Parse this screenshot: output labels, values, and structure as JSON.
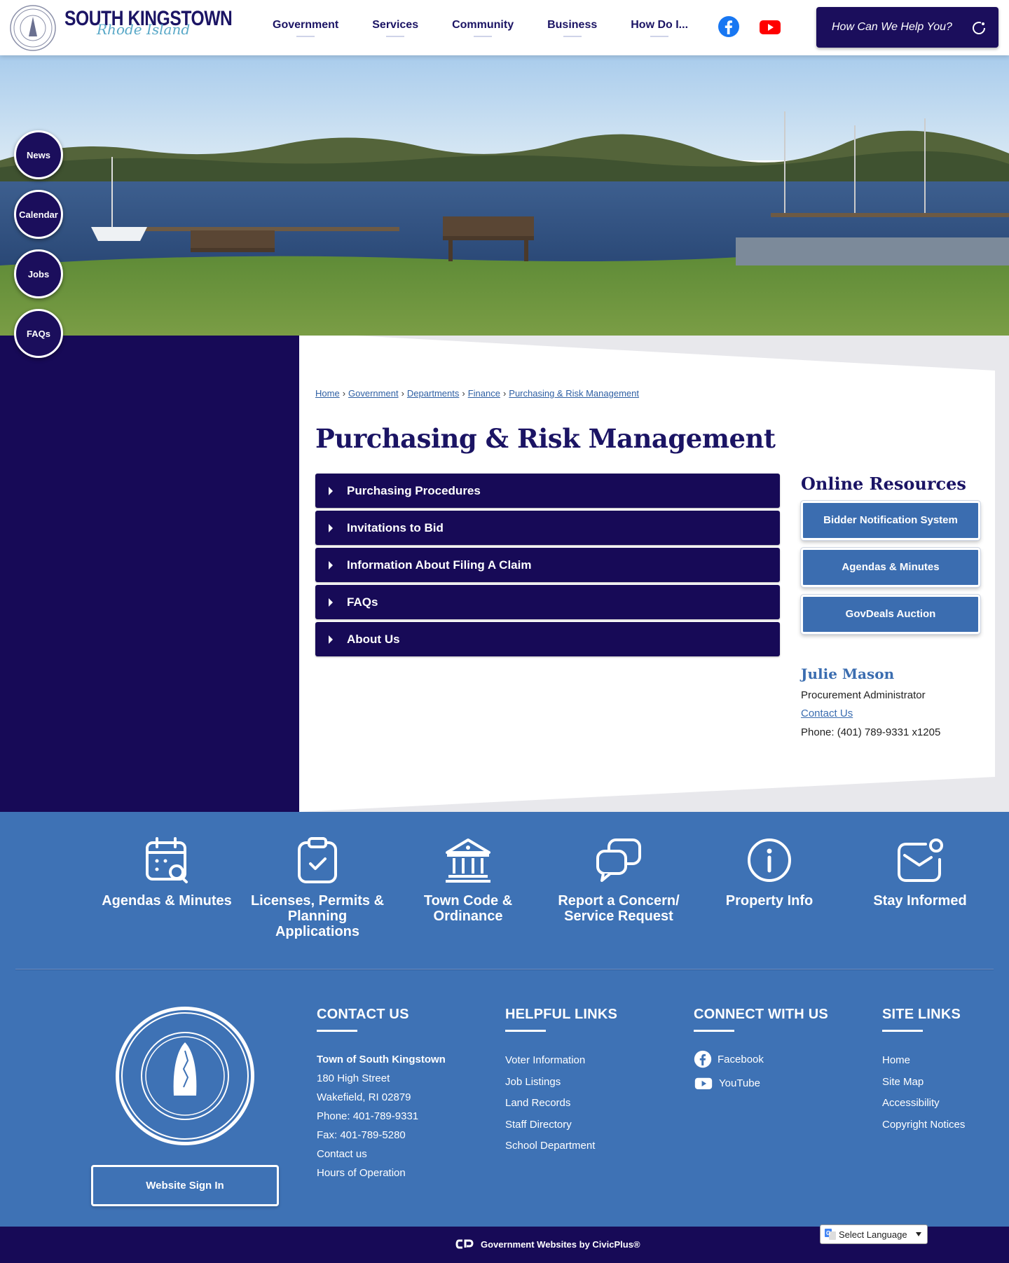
{
  "header": {
    "logo_main": "SOUTH KINGSTOWN",
    "logo_script": "Rhode Island",
    "nav": [
      "Government",
      "Services",
      "Community",
      "Business",
      "How Do I..."
    ],
    "social_icons": [
      "facebook-icon",
      "youtube-icon"
    ],
    "search_label": "How Can We Help You?"
  },
  "quick_circles": [
    "News",
    "Calendar",
    "Jobs",
    "FAQs"
  ],
  "breadcrumb": [
    "Home",
    "Government",
    "Departments",
    "Finance",
    "Purchasing & Risk Management"
  ],
  "breadcrumb_sep": "›",
  "page_title": "Purchasing & Risk Management",
  "accordion": [
    "Purchasing Procedures",
    "Invitations to Bid",
    "Information About Filing A Claim",
    "FAQs",
    "About Us"
  ],
  "resources": {
    "title": "Online Resources",
    "buttons": [
      "Bidder Notification System",
      "Agendas & Minutes",
      "GovDeals Auction"
    ]
  },
  "contact": {
    "name": "Julie Mason",
    "role": "Procurement Administrator",
    "link": "Contact Us",
    "phone": "Phone: (401) 789-9331 x1205"
  },
  "quick_links": [
    {
      "label": "Agendas & Minutes",
      "icon": "calendar-search-icon"
    },
    {
      "label": "Licenses, Permits & Planning Applications",
      "icon": "clipboard-check-icon"
    },
    {
      "label": "Town Code & Ordinance",
      "icon": "building-columns-icon"
    },
    {
      "label": "Report a Concern/ Service Request",
      "icon": "chat-bubbles-icon"
    },
    {
      "label": "Property Info",
      "icon": "info-circle-icon"
    },
    {
      "label": "Stay Informed",
      "icon": "mail-notification-icon"
    }
  ],
  "footer": {
    "signin": "Website Sign In",
    "contact": {
      "heading": "CONTACT US",
      "org": "Town of South Kingstown",
      "lines": [
        "180 High Street",
        "Wakefield, RI 02879",
        "Phone: 401-789-9331",
        "Fax: 401-789-5280",
        "Contact us",
        "Hours of Operation"
      ]
    },
    "helpful": {
      "heading": "HELPFUL LINKS",
      "links": [
        "Voter Information",
        "Job Listings",
        "Land Records",
        "Staff Directory",
        "School Department"
      ]
    },
    "connect": {
      "heading": "CONNECT WITH US",
      "links": [
        "Facebook",
        "YouTube"
      ]
    },
    "site": {
      "heading": "SITE LINKS",
      "links": [
        "Home",
        "Site Map",
        "Accessibility",
        "Copyright Notices"
      ]
    }
  },
  "bottom": {
    "credit": "Government Websites by CivicPlus®",
    "language": "Select Language"
  },
  "colors": {
    "navy": "#170a57",
    "blue": "#3e72b5",
    "title_navy": "#1b1464",
    "link_blue": "#2e5fa3",
    "facebook": "#1877f2",
    "youtube": "#ff0000"
  }
}
